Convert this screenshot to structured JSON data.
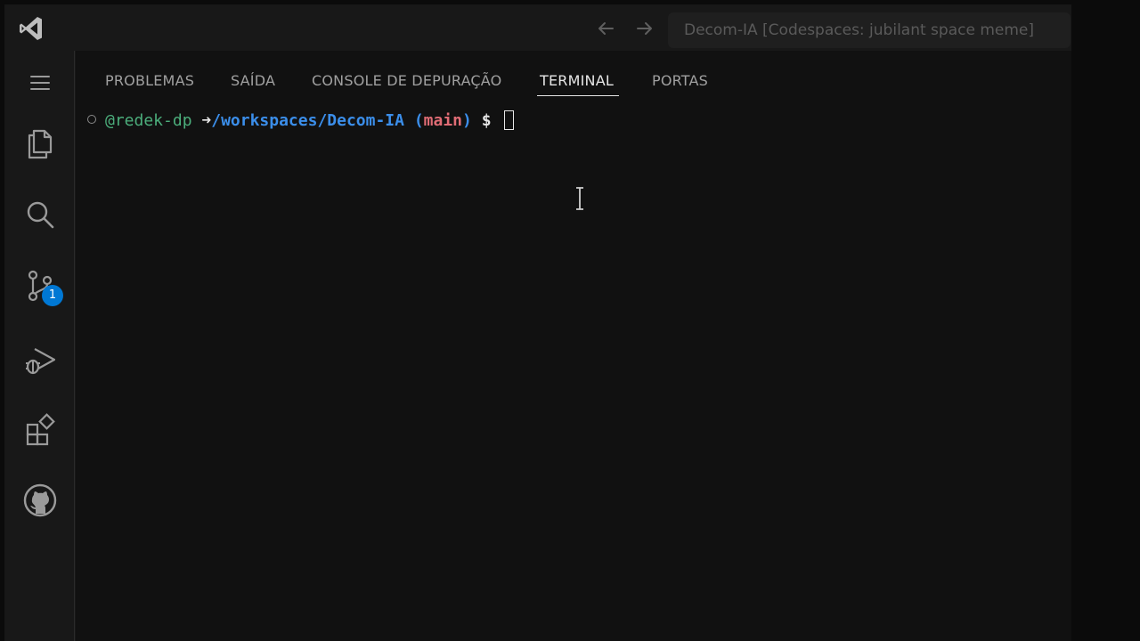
{
  "window": {
    "title": "Decom-IA [Codespaces: jubilant space meme]"
  },
  "titlebar": {
    "logo_icon": "vscode-logo-icon",
    "back_icon": "arrow-left-icon",
    "forward_icon": "arrow-right-icon"
  },
  "activitybar": {
    "items": [
      {
        "icon": "menu-icon",
        "label": "Menu"
      },
      {
        "icon": "explorer-files-icon",
        "label": "Explorer"
      },
      {
        "icon": "search-icon",
        "label": "Search"
      },
      {
        "icon": "source-control-icon",
        "label": "Source Control",
        "badge": "1"
      },
      {
        "icon": "run-debug-icon",
        "label": "Run and Debug"
      },
      {
        "icon": "extensions-icon",
        "label": "Extensions"
      },
      {
        "icon": "github-icon",
        "label": "GitHub"
      }
    ]
  },
  "panel": {
    "tabs": [
      {
        "label": "PROBLEMAS",
        "active": false
      },
      {
        "label": "SAÍDA",
        "active": false
      },
      {
        "label": "CONSOLE DE DEPURAÇÃO",
        "active": false
      },
      {
        "label": "TERMINAL",
        "active": true
      },
      {
        "label": "PORTAS",
        "active": false
      }
    ]
  },
  "terminal": {
    "user": "@redek-dp",
    "arrow": "➜",
    "path": "/workspaces/Decom-IA",
    "paren_open": "(",
    "branch": "main",
    "paren_close": ")",
    "dollar": "$"
  },
  "colors": {
    "accent": "#0078d4",
    "user": "#4cae7c",
    "path": "#3b8eea",
    "branch": "#e06c75"
  }
}
